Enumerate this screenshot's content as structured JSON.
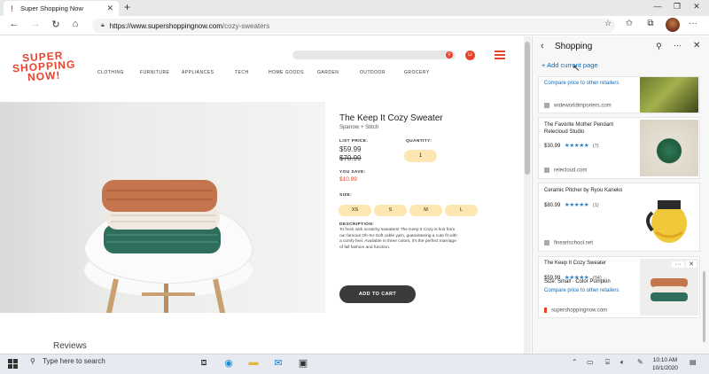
{
  "browser": {
    "tab_title": "Super Shopping Now",
    "tab_icon": "!",
    "url_domain": "https://www.supershoppingnow.com",
    "url_path": "/cozy-sweaters"
  },
  "site": {
    "logo_lines": [
      "SUPER",
      "SHOPPING",
      "NOW!"
    ],
    "nav": [
      "CLOTHING",
      "FURNITURE",
      "APPLIANCES",
      "TECH",
      "HOME GOODS",
      "GARDEN",
      "OUTDOOR",
      "GROCERY"
    ],
    "brand_color": "#e8432e"
  },
  "product": {
    "title": "The Keep It Cozy Sweater",
    "brand": "Sparrow + Stitch",
    "list_price_label": "LIST PRICE:",
    "price": "$59.99",
    "old_price": "$70.99",
    "quantity_label": "QUANTITY:",
    "quantity": "1",
    "you_save_label": "YOU SAVE:",
    "you_save": "$10.99",
    "size_label": "SIZE:",
    "sizes": [
      "XS",
      "S",
      "M",
      "L"
    ],
    "description_label": "DESCRIPTION:",
    "description": "To heck with scratchy sweaters! The Keep It Cozy is knit from our famous Oh-So-Soft cable yarn, guaranteeing a cute fit with a comfy feel. Available in three colors, it's the perfect marriage of fall fashion and function.",
    "add_to_cart": "ADD TO CART",
    "reviews_heading": "Reviews"
  },
  "pane": {
    "title": "Shopping",
    "add_current_page": "Add current page",
    "stars": "★★★★★",
    "cards": [
      {
        "compare": "Compare price to other retailers",
        "domain": "wideworldimporters.com"
      },
      {
        "title_line1": "The Favorite Mother Pendant",
        "title_line2": "Relecloud Studio",
        "price": "$30.99",
        "count": "(7)",
        "domain": "relecloud.com"
      },
      {
        "title_line1": "Ceramic Pitcher by Ryou Kaneko",
        "price": "$80.99",
        "count": "(1)",
        "domain": "fineartschool.net"
      },
      {
        "title_line1": "The Keep It Cozy Sweater",
        "price": "$59.99",
        "count": "(94)",
        "variant": "Size: Small · Color Pumpkin",
        "compare": "Compare price to other retailers",
        "domain": "supershoppingnow.com"
      }
    ]
  },
  "taskbar": {
    "search_placeholder": "Type here to search",
    "time": "10:10 AM",
    "date": "10/1/2020"
  }
}
